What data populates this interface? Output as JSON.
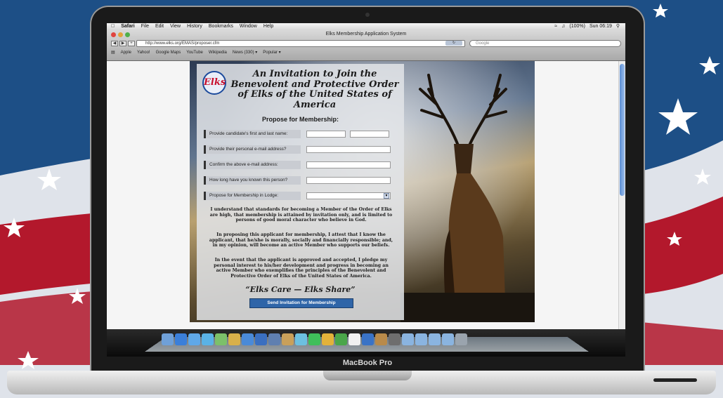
{
  "device": {
    "brand": "MacBook Pro"
  },
  "menubar": {
    "apple": "",
    "app": "Safari",
    "items": [
      "File",
      "Edit",
      "View",
      "History",
      "Bookmarks",
      "Window",
      "Help"
    ],
    "battery": "(100%)",
    "clock": "Sun 06:19"
  },
  "browser": {
    "window_title": "Elks Membership Application System",
    "url": "http://www.elks.org/EMAS/proposer.cfm",
    "search_placeholder": "Google",
    "bookmarks": [
      "Apple",
      "Yahoo!",
      "Google Maps",
      "YouTube",
      "Wikipedia",
      "News (330) ▾",
      "Popular ▾"
    ]
  },
  "page": {
    "logo_text": "Elks",
    "heading": "An Invitation to Join the Benevolent and Protective Order of Elks of the United States of America",
    "subheading": "Propose for Membership:",
    "fields": [
      {
        "label": "Provide candidate's first and last name:"
      },
      {
        "label": "Provide their personal e-mail address?"
      },
      {
        "label": "Confirm the above e-mail address:"
      },
      {
        "label": "How long have you known this person?"
      },
      {
        "label": "Propose for Membership in Lodge:"
      }
    ],
    "paragraphs": [
      "I understand that standards for becoming a Member of the Order of Elks are high, that membership is attained by invitation only, and is limited to persons of good moral character who believe in God.",
      "In proposing this applicant for membership, I attest that I know the applicant, that he/she is morally, socially and financially responsible; and, in my opinion, will become an active Member who supports our beliefs.",
      "In the event that the applicant is approved and accepted, I pledge my personal interest to his/her development and progress in becoming an active Member who exemplifies the principles of the Benevolent and Protective Order of Elks of the United States of America."
    ],
    "motto": "“Elks Care — Elks Share”",
    "submit_label": "Send Invitation for Membership"
  },
  "colors": {
    "flag_blue": "#1d4f86",
    "flag_red": "#b3182c",
    "button": "#2f65a8"
  }
}
